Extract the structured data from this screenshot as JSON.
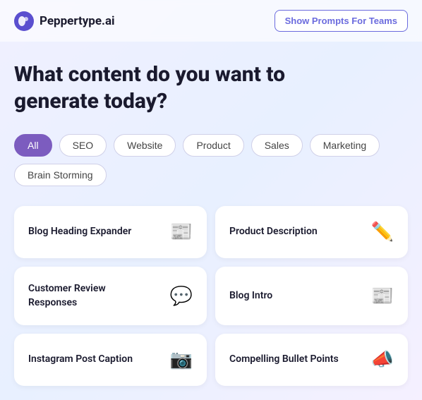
{
  "header": {
    "logo_text": "Peppertype.ai",
    "show_prompts_label": "Show Prompts For Teams"
  },
  "main": {
    "headline_line1": "What content do you want to",
    "headline_line2": "generate today?"
  },
  "filters": {
    "tabs": [
      {
        "id": "all",
        "label": "All",
        "active": true
      },
      {
        "id": "seo",
        "label": "SEO",
        "active": false
      },
      {
        "id": "website",
        "label": "Website",
        "active": false
      },
      {
        "id": "product",
        "label": "Product",
        "active": false
      },
      {
        "id": "sales",
        "label": "Sales",
        "active": false
      },
      {
        "id": "marketing",
        "label": "Marketing",
        "active": false
      },
      {
        "id": "brainstorming",
        "label": "Brain Storming",
        "active": false
      }
    ]
  },
  "cards": [
    {
      "id": "blog-heading-expander",
      "title": "Blog Heading Expander",
      "icon": "📰"
    },
    {
      "id": "product-description",
      "title": "Product Description",
      "icon": "✏️"
    },
    {
      "id": "customer-review-responses",
      "title": "Customer Review Responses",
      "icon": "💬"
    },
    {
      "id": "blog-intro",
      "title": "Blog Intro",
      "icon": "📰"
    },
    {
      "id": "instagram-post-caption",
      "title": "Instagram Post Caption",
      "icon": "📷"
    },
    {
      "id": "compelling-bullet-points",
      "title": "Compelling Bullet Points",
      "icon": "📣"
    }
  ]
}
